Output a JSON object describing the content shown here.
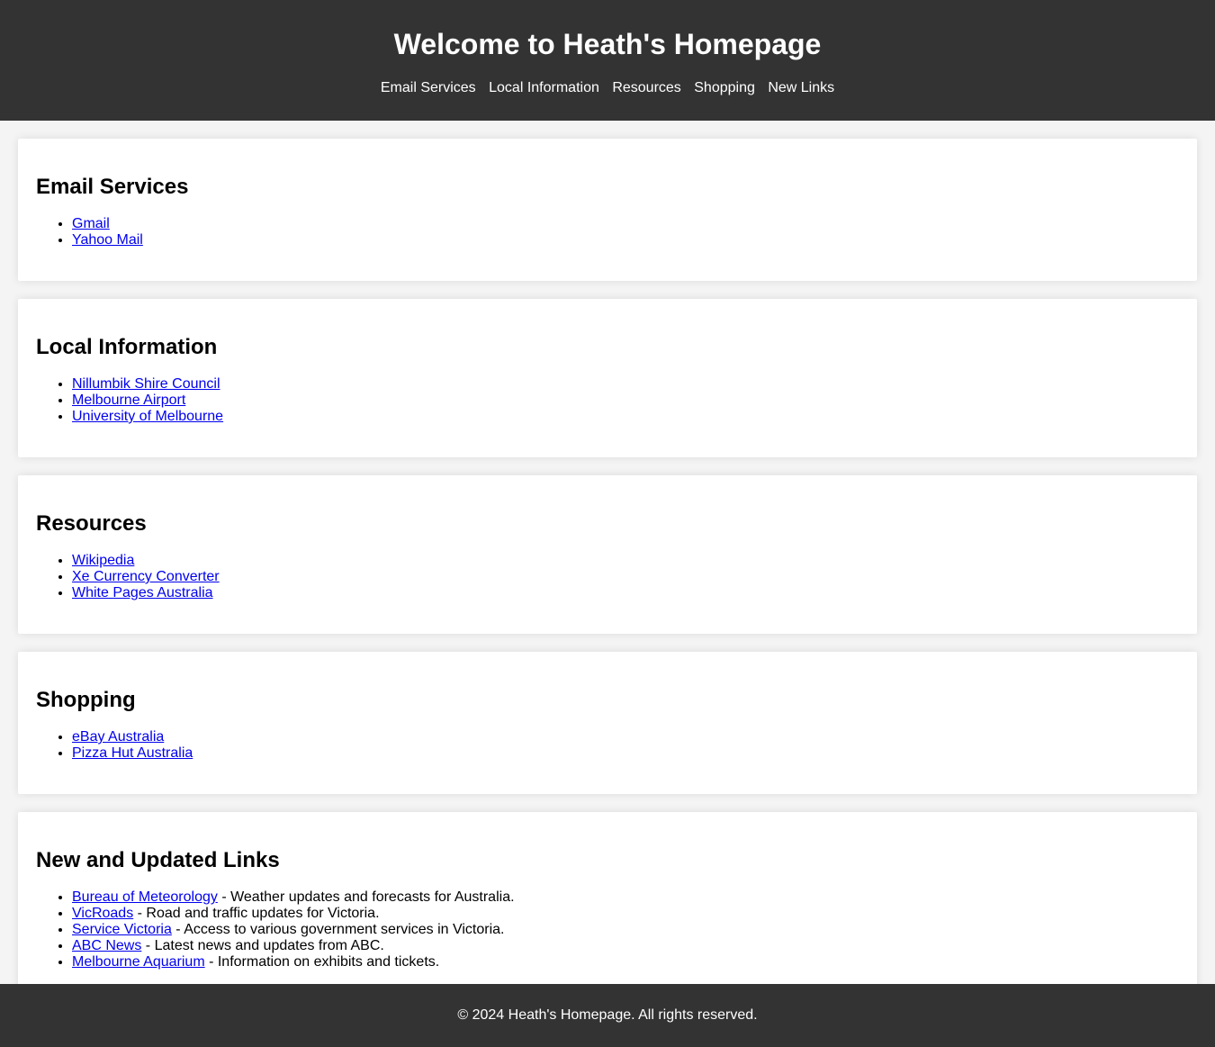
{
  "header": {
    "title": "Welcome to Heath's Homepage",
    "nav": [
      {
        "label": "Email Services"
      },
      {
        "label": "Local Information"
      },
      {
        "label": "Resources"
      },
      {
        "label": "Shopping"
      },
      {
        "label": "New Links"
      }
    ]
  },
  "sections": {
    "email": {
      "title": "Email Services",
      "links": [
        "Gmail",
        "Yahoo Mail"
      ]
    },
    "local": {
      "title": "Local Information",
      "links": [
        "Nillumbik Shire Council",
        "Melbourne Airport",
        "University of Melbourne"
      ]
    },
    "resources": {
      "title": "Resources",
      "links": [
        "Wikipedia",
        "Xe Currency Converter",
        "White Pages Australia"
      ]
    },
    "shopping": {
      "title": "Shopping",
      "links": [
        "eBay Australia",
        "Pizza Hut Australia"
      ]
    },
    "new": {
      "title": "New and Updated Links",
      "items": [
        {
          "link": "Bureau of Meteorology",
          "desc": " - Weather updates and forecasts for Australia."
        },
        {
          "link": "VicRoads",
          "desc": " - Road and traffic updates for Victoria."
        },
        {
          "link": "Service Victoria",
          "desc": " - Access to various government services in Victoria."
        },
        {
          "link": "ABC News",
          "desc": " - Latest news and updates from ABC."
        },
        {
          "link": "Melbourne Aquarium",
          "desc": " - Information on exhibits and tickets."
        }
      ]
    }
  },
  "footer": {
    "text": "© 2024 Heath's Homepage. All rights reserved."
  }
}
